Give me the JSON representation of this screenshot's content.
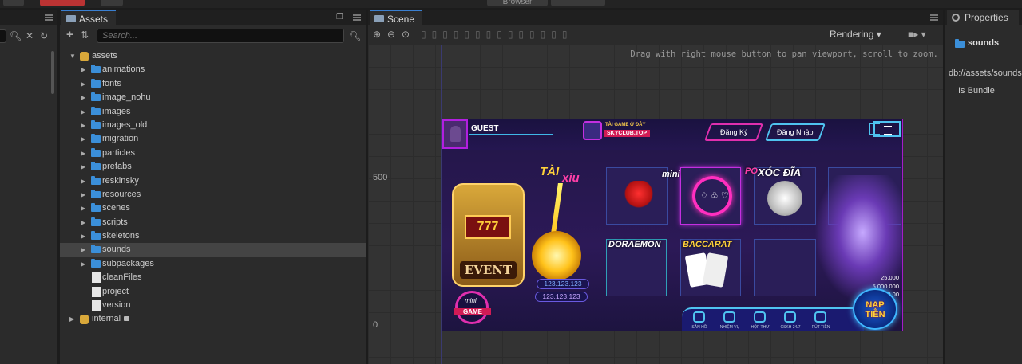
{
  "topbar": {
    "browser_label": "Browser"
  },
  "assets": {
    "tab_label": "Assets",
    "search_placeholder": "Search...",
    "tree": {
      "root": "assets",
      "folders": [
        "animations",
        "fonts",
        "image_nohu",
        "images",
        "images_old",
        "migration",
        "particles",
        "prefabs",
        "reskinsky",
        "resources",
        "scenes",
        "scripts",
        "skeletons",
        "sounds",
        "subpackages"
      ],
      "selected": "sounds",
      "files": [
        "cleanFiles",
        "project",
        "version"
      ],
      "internal": "internal"
    }
  },
  "scene": {
    "tab_label": "Scene",
    "hint": "Drag with right mouse button to pan viewport, scroll to zoom.",
    "rendering_label": "Rendering",
    "axis_labels": [
      "500",
      "0"
    ],
    "game": {
      "guest": "GUEST",
      "logo_line1": "TÀI GAME Ở ĐÂY",
      "logo_line2": "SKYCLUB.TOP",
      "register": "Đăng Ký",
      "login": "Đăng Nhập",
      "taixiu_1": "TÀI",
      "taixiu_2": "xỉu",
      "mini_label": "mini",
      "xocdia": "XÓC ĐĨA",
      "po_label": "PO",
      "doraemon": "DORAEMON",
      "baccarat": "BACCARAT",
      "event": "EVENT",
      "slot_reel": "777",
      "jackpot_1": "123.123.123",
      "jackpot_2": "123.123.123",
      "minigame_1": "mini",
      "minigame_2": "GAME",
      "bonus_1": "25.000",
      "bonus_2": "5.000.000",
      "bonus_3": "500.00",
      "naptien_1": "NẠP",
      "naptien_2": "TIỀN",
      "bottom_items": [
        "SẢN HỒ",
        "NHIỆM VỤ",
        "HỘP THƯ",
        "CSKH 24/7",
        "RÚT TIỀN"
      ]
    }
  },
  "properties": {
    "tab_label": "Properties",
    "asset_name": "sounds",
    "path": "db://assets/sounds",
    "bundle_label": "Is Bundle"
  }
}
